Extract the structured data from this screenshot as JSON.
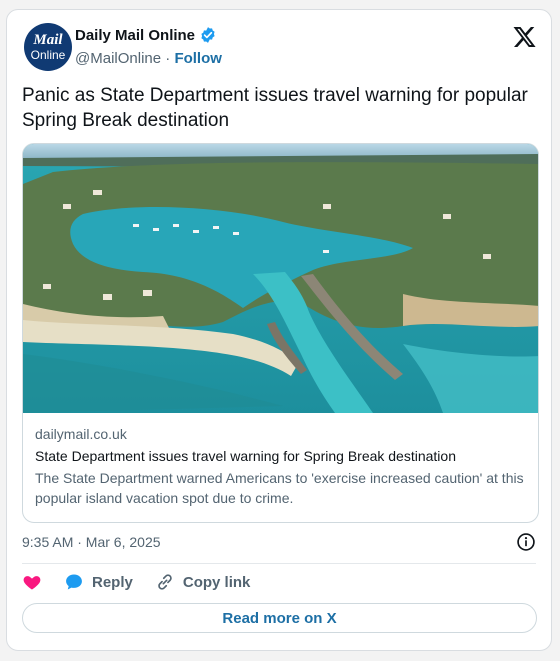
{
  "account": {
    "avatar_line1": "Mail",
    "avatar_line2": "Online",
    "display_name": "Daily Mail Online",
    "handle": "@MailOnline",
    "separator": "·",
    "follow_label": "Follow"
  },
  "tweet": {
    "text": "Panic as State Department issues travel warning for popular Spring Break destination",
    "timestamp": "9:35 AM · Mar 6, 2025"
  },
  "link_card": {
    "image": "aerial-island-marina",
    "domain": "dailymail.co.uk",
    "title": "State Department issues travel warning for Spring Break destination",
    "description": "The State Department warned Americans to 'exercise increased caution' at this popular island vacation spot due to crime."
  },
  "actions": {
    "reply_label": "Reply",
    "copy_link_label": "Copy link",
    "read_more_label": "Read more on X"
  },
  "colors": {
    "link_blue": "#1d6fa5",
    "verified_blue": "#1d9bf0",
    "like_pink": "#f91880",
    "avatar_navy": "#103a73"
  },
  "icons": [
    "verified-badge-icon",
    "x-logo-icon",
    "info-icon",
    "heart-icon",
    "reply-bubble-icon",
    "link-icon"
  ]
}
